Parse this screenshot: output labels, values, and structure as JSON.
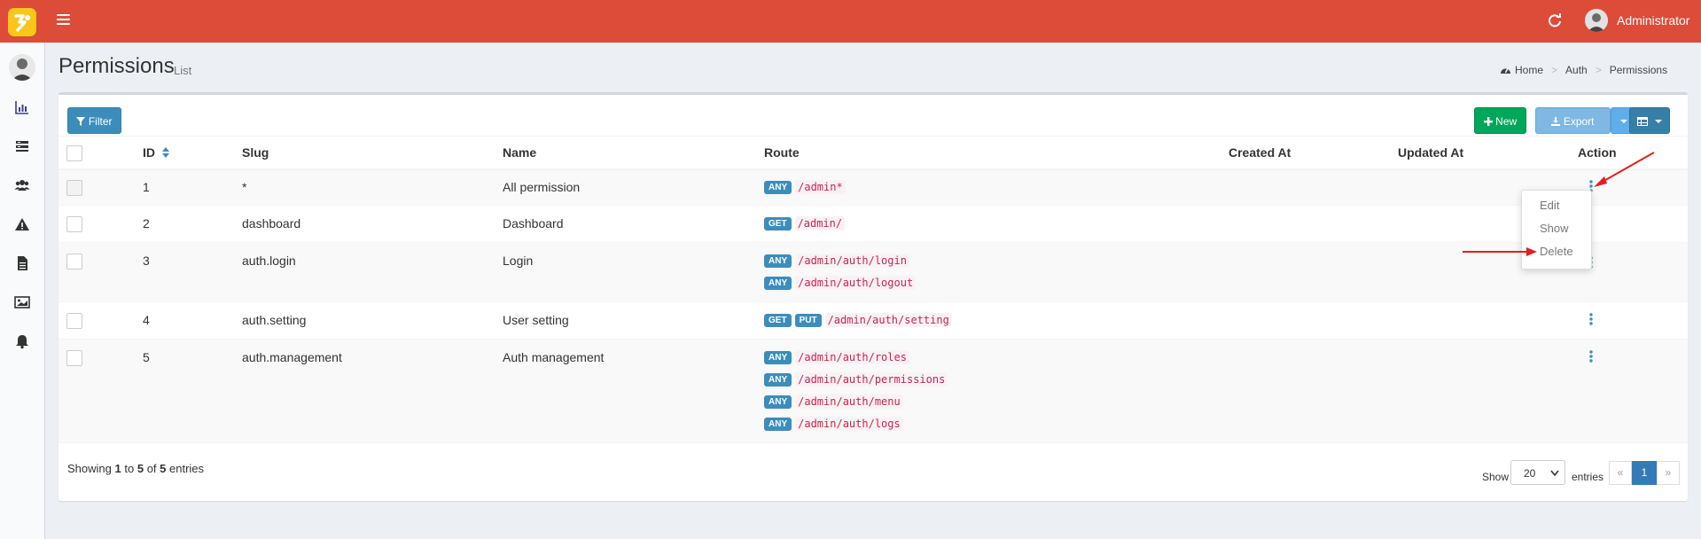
{
  "header": {
    "user_name": "Administrator",
    "brand_color": "#dd4b39",
    "icons": [
      "logo-icon",
      "hamburger-icon",
      "refresh-icon",
      "user-avatar"
    ]
  },
  "sidebar": {
    "icons": [
      "user-avatar",
      "dashboard-chart-icon",
      "list-icon",
      "users-icon",
      "warning-icon",
      "file-icon",
      "image-icon",
      "bell-icon"
    ]
  },
  "page": {
    "title": "Permissions",
    "subtitle": "List",
    "breadcrumb": [
      "Home",
      "Auth",
      "Permissions"
    ]
  },
  "toolbar": {
    "filter_label": "Filter",
    "new_label": "New",
    "export_label": "Export"
  },
  "table": {
    "columns": [
      "ID",
      "Slug",
      "Name",
      "Route",
      "Created At",
      "Updated At",
      "Action"
    ],
    "rows": [
      {
        "id": "1",
        "slug": "*",
        "name": "All permission",
        "routes": [
          {
            "methods": [
              "ANY"
            ],
            "path": "/admin*"
          }
        ]
      },
      {
        "id": "2",
        "slug": "dashboard",
        "name": "Dashboard",
        "routes": [
          {
            "methods": [
              "GET"
            ],
            "path": "/admin/"
          }
        ]
      },
      {
        "id": "3",
        "slug": "auth.login",
        "name": "Login",
        "routes": [
          {
            "methods": [
              "ANY"
            ],
            "path": "/admin/auth/login"
          },
          {
            "methods": [
              "ANY"
            ],
            "path": "/admin/auth/logout"
          }
        ]
      },
      {
        "id": "4",
        "slug": "auth.setting",
        "name": "User setting",
        "routes": [
          {
            "methods": [
              "GET",
              "PUT"
            ],
            "path": "/admin/auth/setting"
          }
        ]
      },
      {
        "id": "5",
        "slug": "auth.management",
        "name": "Auth management",
        "routes": [
          {
            "methods": [
              "ANY"
            ],
            "path": "/admin/auth/roles"
          },
          {
            "methods": [
              "ANY"
            ],
            "path": "/admin/auth/permissions"
          },
          {
            "methods": [
              "ANY"
            ],
            "path": "/admin/auth/menu"
          },
          {
            "methods": [
              "ANY"
            ],
            "path": "/admin/auth/logs"
          }
        ]
      }
    ]
  },
  "action_menu": {
    "items": [
      "Edit",
      "Show",
      "Delete"
    ]
  },
  "footer": {
    "showing_prefix": "Showing",
    "from": "1",
    "to_word": "to",
    "to": "5",
    "of_word": "of",
    "total": "5",
    "entries_word": "entries",
    "show_label": "Show",
    "per_page": "20",
    "entries_label": "entries",
    "prev": "«",
    "page": "1",
    "next": "»"
  }
}
